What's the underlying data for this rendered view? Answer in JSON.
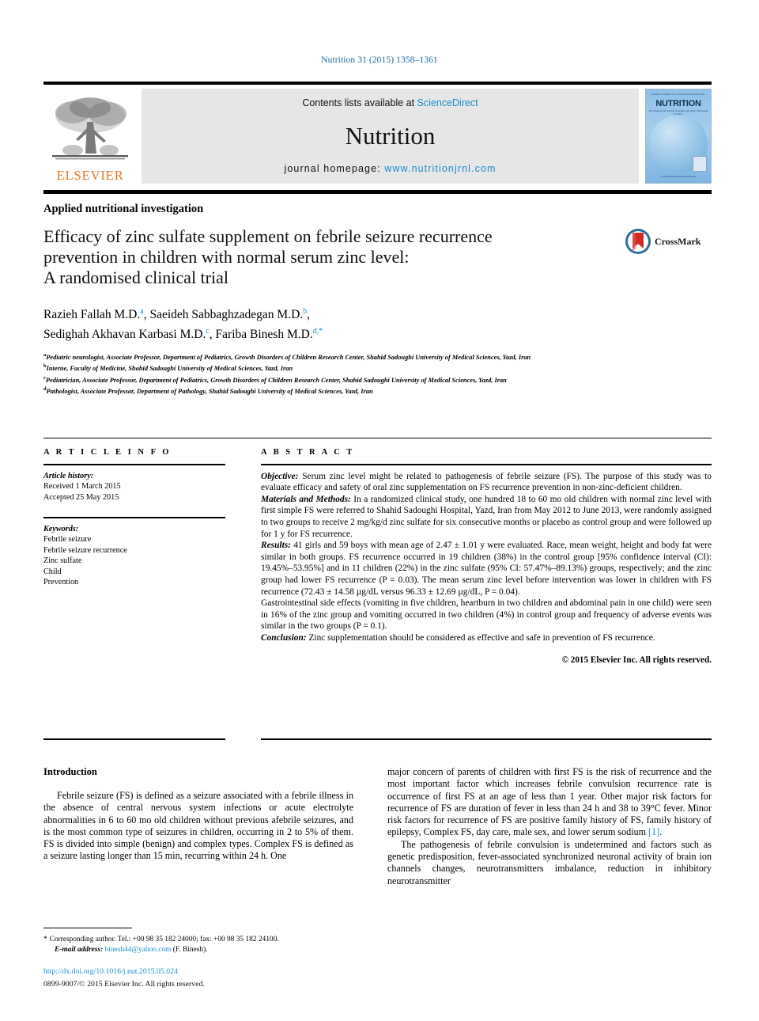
{
  "running_head": "Nutrition 31 (2015) 1358–1361",
  "masthead": {
    "contents_prefix": "Contents lists available at ",
    "sciencedirect": "ScienceDirect",
    "journal_name": "Nutrition",
    "homepage_prefix": "journal homepage: ",
    "homepage_url": "www.nutritionjrnl.com",
    "publisher": "ELSEVIER",
    "cover": {
      "title": "NUTRITION",
      "subtitle": "The International Journal of Applied and Basic Nutritional Sciences",
      "issue": "Volume 31 Number 11/12 November/December 2015",
      "footer": "ELSEVIER INTERNATIONAL"
    }
  },
  "article": {
    "kicker": "Applied nutritional investigation",
    "title_line1": "Efficacy of zinc sulfate supplement on febrile seizure recurrence",
    "title_line2": "prevention in children with normal serum zinc level:",
    "title_line3": "A randomised clinical trial",
    "crossmark_label": "CrossMark",
    "authors": [
      {
        "name": "Razieh Fallah M.D.",
        "sup": "a",
        "sep": ", "
      },
      {
        "name": "Saeideh Sabbaghzadegan M.D.",
        "sup": "b",
        "sep": ","
      },
      {
        "name": "Sedighah Akhavan Karbasi M.D.",
        "sup": "c",
        "sep": ", "
      },
      {
        "name": "Fariba Binesh M.D.",
        "sup": "d,*",
        "sep": ""
      }
    ],
    "affiliations": [
      {
        "mark": "a",
        "text": "Pediatric neurologist, Associate Professor, Department of Pediatrics, Growth Disorders of Children Research Center, Shahid Sadoughi University of Medical Sciences, Yazd, Iran"
      },
      {
        "mark": "b",
        "text": "Interne, Faculty of Medicine, Shahid Sadoughi University of Medical Sciences, Yazd, Iran"
      },
      {
        "mark": "c",
        "text": "Pediatrician, Associate Professor, Department of Pediatrics, Growth Disorders of Children Research Center, Shahid Sadoughi University of Medical Sciences, Yazd, Iran"
      },
      {
        "mark": "d",
        "text": "Pathologist, Associate Professor, Department of Pathology, Shahid Sadoughi University of Medical Sciences, Yazd, Iran"
      }
    ]
  },
  "article_info": {
    "heading": "A R T I C L E   I N F O",
    "history_label": "Article history:",
    "received": "Received 1 March 2015",
    "accepted": "Accepted 25 May 2015",
    "keywords_label": "Keywords:",
    "keywords": [
      "Febrile seizure",
      "Febrile seizure recurrence",
      "Zinc sulfate",
      "Child",
      "Prevention"
    ]
  },
  "abstract": {
    "heading": "A B S T R A C T",
    "objective_label": "Objective:",
    "objective_text": " Serum zinc level might be related to pathogenesis of febrile seizure (FS). The purpose of this study was to evaluate efficacy and safety of oral zinc supplementation on FS recurrence prevention in non-zinc-deficient children.",
    "methods_label": "Materials and Methods:",
    "methods_text": " In a randomized clinical study, one hundred 18 to 60 mo old children with normal zinc level with first simple FS were referred to Shahid Sadoughi Hospital, Yazd, Iran from May 2012 to June 2013, were randomly assigned to two groups to receive 2 mg/kg/d zinc sulfate for six consecutive months or placebo as control group and were followed up for 1 y for FS recurrence.",
    "results_label": "Results:",
    "results_text": " 41 girls and 59 boys with mean age of 2.47 ± 1.01 y were evaluated. Race, mean weight, height and body fat were similar in both groups. FS recurrence occurred in 19 children (38%) in the control group [95% confidence interval (CI): 19.45%–53.95%] and in 11 children (22%) in the zinc sulfate (95% CI: 57.47%–89.13%) groups, respectively; and the zinc group had lower FS recurrence (P = 0.03). The mean serum zinc level before intervention was lower in children with FS recurrence (72.43 ± 14.58 µg/dL versus 96.33 ± 12.69 µg/dL, P = 0.04).",
    "side_effects_text": "Gastrointestinal side effects (vomiting in five children, heartburn in two children and abdominal pain in one child) were seen in 16% of the zinc group and vomiting occurred in two children (4%) in control group and frequency of adverse events was similar in the two groups (P = 0.1).",
    "conclusion_label": "Conclusion:",
    "conclusion_text": " Zinc supplementation should be considered as effective and safe in prevention of FS recurrence.",
    "copyright": "© 2015 Elsevier Inc. All rights reserved."
  },
  "introduction": {
    "heading": "Introduction",
    "left_p1": "Febrile seizure (FS) is defined as a seizure associated with a febrile illness in the absence of central nervous system infections or acute electrolyte abnormalities in 6 to 60 mo old children without previous afebrile seizures, and is the most common type of seizures in children, occurring in 2 to 5% of them. FS is divided into simple (benign) and complex types. Complex FS is defined as a seizure lasting longer than 15 min, recurring within 24 h. One",
    "right_p1": "major concern of parents of children with first FS is the risk of recurrence and the most important factor which increases febrile convulsion recurrence rate is occurrence of first FS at an age of less than 1 year. Other major risk factors for recurrence of FS are duration of fever in less than 24 h and 38 to 39°C fever. Minor risk factors for recurrence of FS are positive family history of FS, family history of epilepsy, Complex FS, day care, male sex, and lower serum sodium ",
    "right_p1_ref": "[1]",
    "right_p1_end": ".",
    "right_p2": "The pathogenesis of febrile convulsion is undetermined and factors such as genetic predisposition, fever-associated synchronized neuronal activity of brain ion channels changes, neurotransmitters imbalance, reduction in inhibitory neurotransmitter"
  },
  "footer": {
    "corresponding_star": "*",
    "corresponding_text": "Corresponding author. Tel.: +00 98 35 182 24000; fax: +00 98 35 182 24100.",
    "email_label": "E-mail address:",
    "email": "binesh44@yahoo.com",
    "email_owner": "(F. Binesh).",
    "doi": "http://dx.doi.org/10.1016/j.nut.2015.05.024",
    "issn": "0899-9007/© 2015 Elsevier Inc. All rights reserved."
  },
  "colors": {
    "link": "#1a8ccb",
    "running_head": "#1a6aa8",
    "elsevier_orange": "#e87722"
  }
}
